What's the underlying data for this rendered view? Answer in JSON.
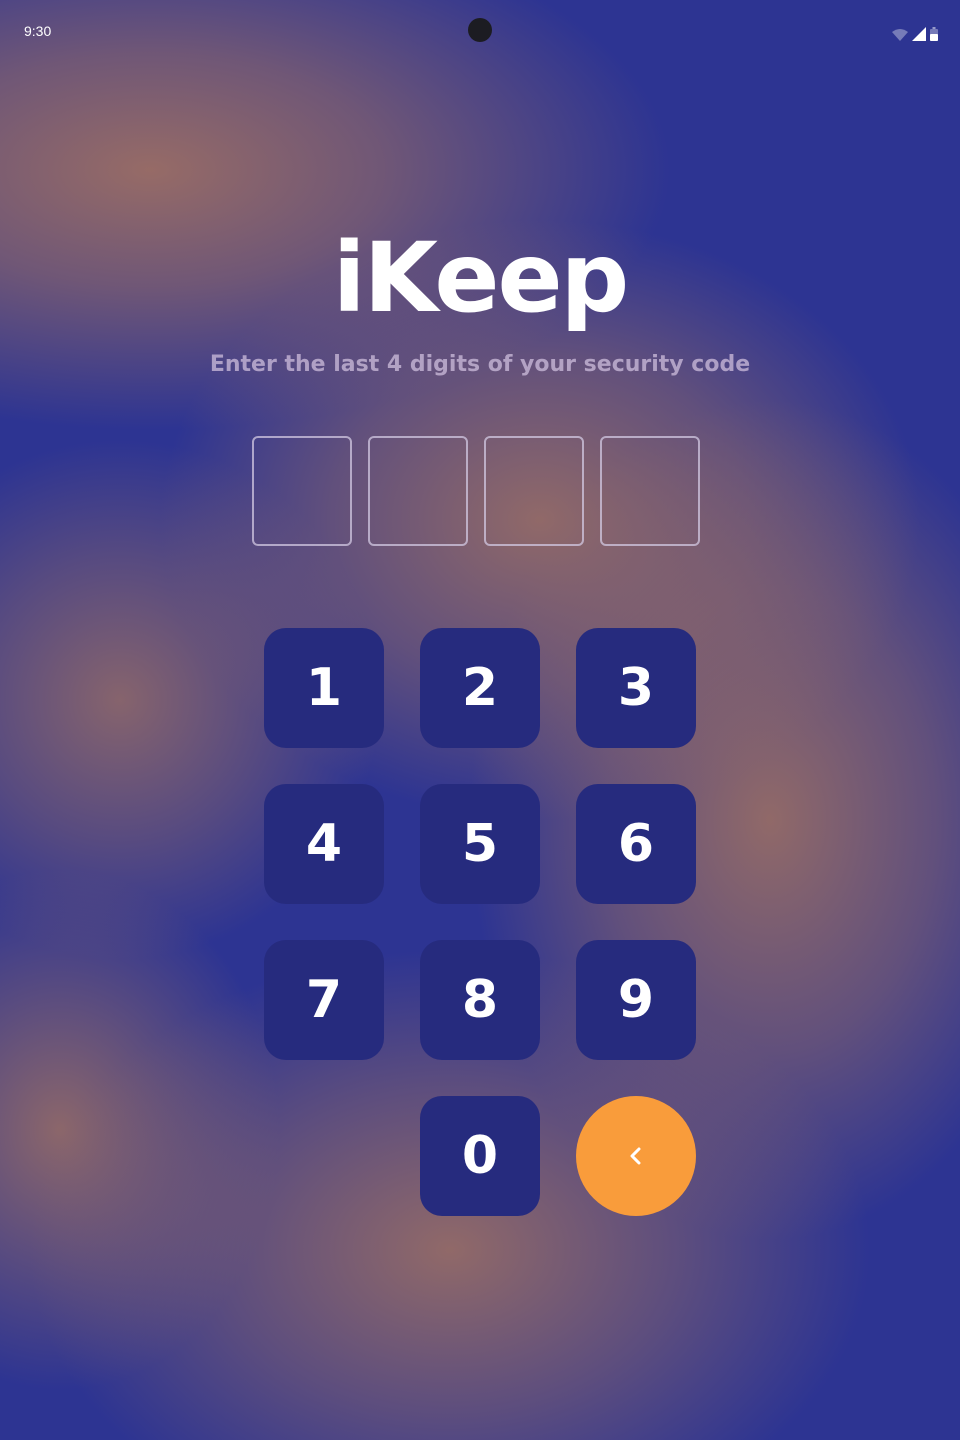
{
  "status_bar": {
    "time": "9:30",
    "icons": [
      "wifi-icon",
      "signal-icon",
      "battery-icon"
    ]
  },
  "app": {
    "title": "iKeep",
    "subtitle": "Enter the last 4 digits of your security code"
  },
  "code_entry": {
    "digits": [
      "",
      "",
      "",
      ""
    ]
  },
  "keypad": {
    "keys": [
      "1",
      "2",
      "3",
      "4",
      "5",
      "6",
      "7",
      "8",
      "9",
      "0"
    ],
    "back_icon": "chevron-left-icon"
  },
  "colors": {
    "background": "#2d3492",
    "background_glow": "#9c6e64",
    "key_background": "#262b7e",
    "back_button": "#f99c3b",
    "text": "#ffffff"
  }
}
